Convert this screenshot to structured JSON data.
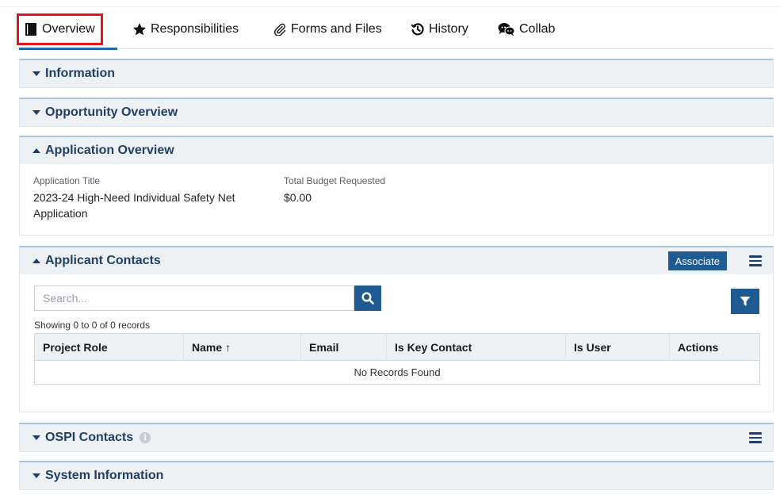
{
  "tabs": [
    {
      "label": "Overview",
      "icon": "book-icon"
    },
    {
      "label": "Responsibilities",
      "icon": "star-icon"
    },
    {
      "label": "Forms and Files",
      "icon": "paperclip-icon"
    },
    {
      "label": "History",
      "icon": "history-icon"
    },
    {
      "label": "Collab",
      "icon": "chat-bubbles-icon"
    }
  ],
  "panels": {
    "information": {
      "title": "Information"
    },
    "opportunity": {
      "title": "Opportunity Overview"
    },
    "application": {
      "title": "Application Overview",
      "fields": [
        {
          "label": "Application Title",
          "value": "2023-24 High-Need Individual Safety Net Application"
        },
        {
          "label": "Total Budget Requested",
          "value": "$0.00"
        }
      ]
    },
    "contacts": {
      "title": "Applicant Contacts",
      "associate_label": "Associate",
      "search_placeholder": "Search...",
      "showing": "Showing 0 to 0 of 0 records",
      "columns": [
        "Project Role",
        "Name ↑",
        "Email",
        "Is Key Contact",
        "Is User",
        "Actions"
      ],
      "empty": "No Records Found"
    },
    "ospi": {
      "title": "OSPI Contacts"
    },
    "system": {
      "title": "System Information"
    }
  },
  "colors": {
    "accent": "#1f5a92",
    "highlight": "#e2141e",
    "panel_header": "#eef1f4",
    "title": "#1f3f66"
  }
}
